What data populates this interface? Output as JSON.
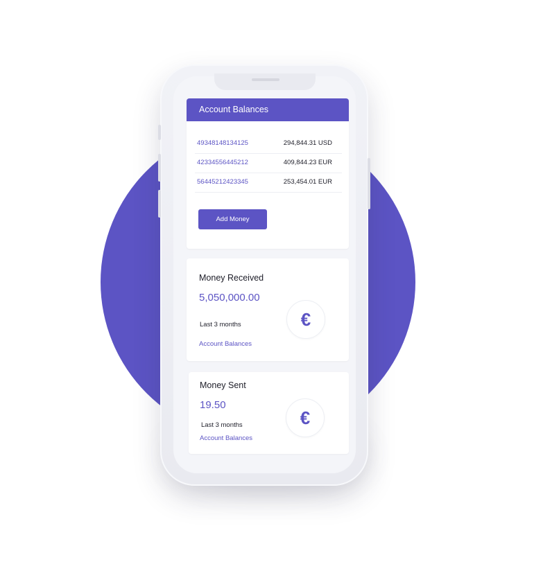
{
  "balances": {
    "title": "Account Balances",
    "rows": [
      {
        "account": "49348148134125",
        "amount": "294,844.31 USD"
      },
      {
        "account": "42334556445212",
        "amount": "409,844.23 EUR"
      },
      {
        "account": "56445212423345",
        "amount": "253,454.01 EUR"
      }
    ],
    "add_money_label": "Add Money"
  },
  "received": {
    "title": "Money Received",
    "value": "5,050,000.00",
    "period": "Last 3 months",
    "link": "Account Balances",
    "icon": "euro-icon",
    "symbol": "€"
  },
  "sent": {
    "title": "Money Sent",
    "value": "19.50",
    "period": "Last 3 months",
    "link": "Account Balances",
    "icon": "euro-icon",
    "symbol": "€"
  },
  "colors": {
    "accent": "#5c54c4",
    "screen_bg": "#f4f5f9",
    "card_bg": "#ffffff"
  }
}
